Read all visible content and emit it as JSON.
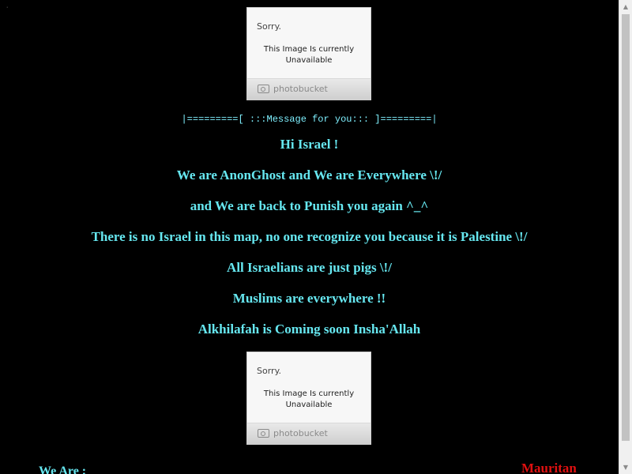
{
  "photobucket_placeholders": [
    {
      "sorry": "Sorry.",
      "message_line1": "This Image Is currently",
      "message_line2": "Unavailable",
      "brand": "photobucket",
      "icon": "camera-icon"
    },
    {
      "sorry": "Sorry.",
      "message_line1": "This Image Is currently",
      "message_line2": "Unavailable",
      "brand": "photobucket",
      "icon": "camera-icon"
    }
  ],
  "banner": "|=========[ :::Message for you::: ]=========|",
  "message_lines": [
    "Hi Israel !",
    "We are AnonGhost and We are Everywhere \\!/",
    "and We are back to Punish you again ^_^",
    "There is no Israel in this map, no one recognize you because it is Palestine \\!/",
    "All Israelians are just pigs \\!/",
    "Muslims are everywhere !!",
    "Alkhilafah is Coming soon Insha'Allah"
  ],
  "footer": {
    "we_are": "We Are :",
    "right_name": "Mauritan"
  },
  "colors": {
    "background": "#000000",
    "text_cyan": "#66e7f0",
    "accent_red": "#e01010"
  }
}
